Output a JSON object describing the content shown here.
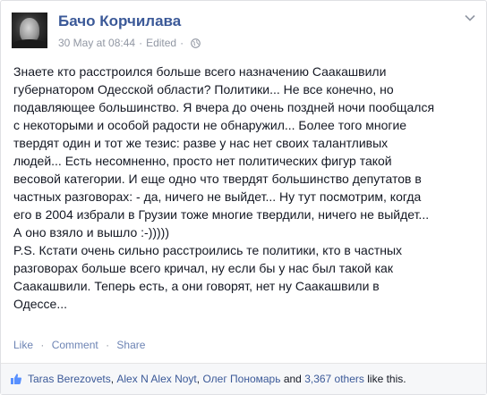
{
  "post": {
    "author": "Бачо Корчилава",
    "date": "30 May at 08:44",
    "separator": "·",
    "edited": "Edited",
    "privacy_icon": "globe-icon",
    "menu_icon": "chevron-down-icon",
    "text_lines": [
      "Знаете кто расстроился больше всего назначению Саакашвили",
      "губернатором Одесской области? Политики... Не все конечно, но",
      "подавляющее большинство. Я вчера до очень поздней ночи пообщался",
      "с некоторыми и особой радости не обнаружил... Более того многие",
      "твердят один и тот же тезис: разве у нас нет своих талантливых",
      "людей... Есть несомненно, просто нет политических фигур такой",
      "весовой категории. И еще одно что твердят большинство депутатов в",
      "частных разговорах: - да, ничего не выйдет... Ну тут посмотрим, когда",
      "его в 2004 избрали в Грузии тоже многие твердили, ничего не выйдет...",
      "А оно взяло и вышло :-)))))",
      "P.S. Кстати очень сильно расстроились те политики, кто в частных",
      "разговорах больше всего кричал, ну если бы у нас был такой как",
      "Саакашвили. Теперь есть, а они говорят, нет ну Саакашвили в",
      "Одессе..."
    ]
  },
  "actions": {
    "like": "Like",
    "comment": "Comment",
    "share": "Share",
    "dot": "·"
  },
  "likes": {
    "icon": "thumbs-up-icon",
    "name1": "Taras Berezovets",
    "comma1": ", ",
    "name2": "Alex N Alex Noyt",
    "comma2": ", ",
    "name3": "Олег Пономарь",
    "and": " and ",
    "others": "3,367 others",
    "suffix": " like this."
  },
  "colors": {
    "link": "#3b5998",
    "meta": "#9197a3",
    "action_link": "#6d84b4",
    "text": "#141823",
    "likes_bg": "#f6f7f9"
  }
}
